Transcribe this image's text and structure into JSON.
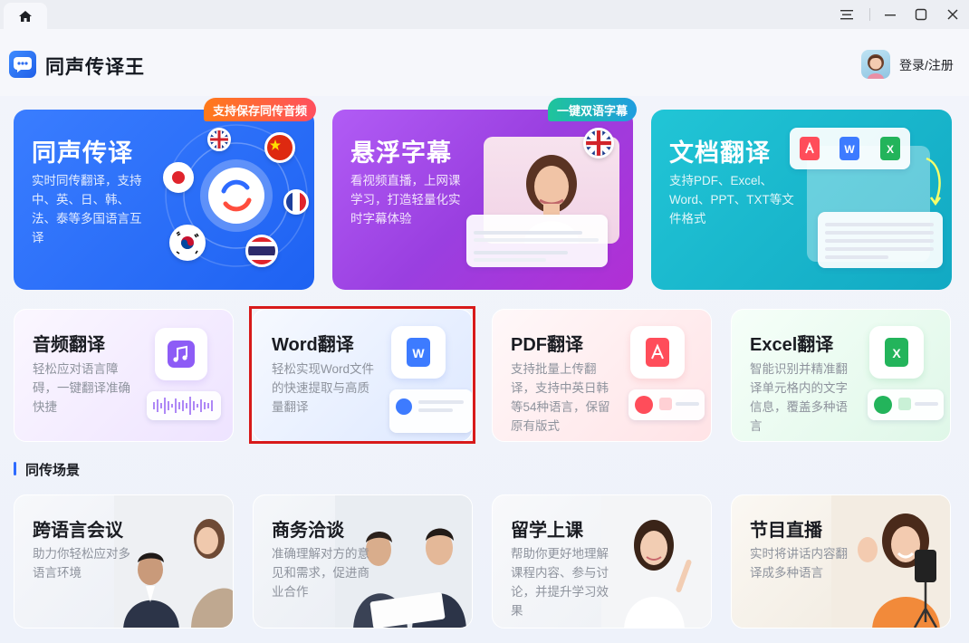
{
  "window": {
    "app_title": "同声传译王",
    "login_label": "登录/注册"
  },
  "feature_cards": [
    {
      "title": "同声传译",
      "desc": "实时同传翻译，支持中、英、日、韩、法、泰等多国语言互译",
      "badge": "支持保存同传音频"
    },
    {
      "title": "悬浮字幕",
      "desc": "看视频直播，上网课学习，打造轻量化实时字幕体验",
      "badge": "一键双语字幕"
    },
    {
      "title": "文档翻译",
      "desc": "支持PDF、Excel、Word、PPT、TXT等文件格式"
    }
  ],
  "tool_cards": [
    {
      "title": "音频翻译",
      "desc": "轻松应对语言障碍，一键翻译准确快捷"
    },
    {
      "title": "Word翻译",
      "desc": "轻松实现Word文件的快速提取与高质量翻译"
    },
    {
      "title": "PDF翻译",
      "desc": "支持批量上传翻译，支持中英日韩等54种语言，保留原有版式"
    },
    {
      "title": "Excel翻译",
      "desc": "智能识别并精准翻译单元格内的文字信息，覆盖多种语言"
    }
  ],
  "section": {
    "title": "同传场景"
  },
  "scene_cards": [
    {
      "title": "跨语言会议",
      "desc": "助力你轻松应对多语言环境"
    },
    {
      "title": "商务洽谈",
      "desc": "准确理解对方的意见和需求，促进商业合作"
    },
    {
      "title": "留学上课",
      "desc": "帮助你更好地理解 课程内容、参与讨论，并提升学习效果"
    },
    {
      "title": "节目直播",
      "desc": "实时将讲话内容翻译成多种语言"
    }
  ],
  "colors": {
    "accent": "#2e6bff",
    "card1": "#2f72ff",
    "card2": "#a341e6",
    "card3": "#17b2c9",
    "highlight": "#d81a1a"
  }
}
